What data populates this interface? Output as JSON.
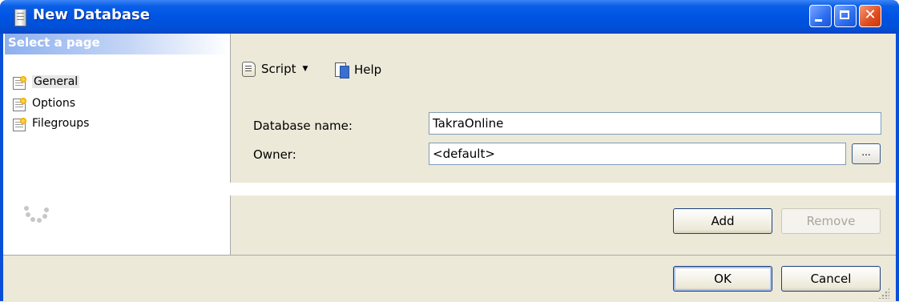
{
  "window": {
    "title": "New Database"
  },
  "sidebar": {
    "header": "Select a page",
    "items": [
      {
        "label": "General",
        "selected": true
      },
      {
        "label": "Options",
        "selected": false
      },
      {
        "label": "Filegroups",
        "selected": false
      }
    ]
  },
  "toolbar": {
    "script_label": "Script",
    "help_label": "Help"
  },
  "form": {
    "database_name_label": "Database name:",
    "database_name_value": "TakraOnline",
    "owner_label": "Owner:",
    "owner_value": "<default>",
    "browse_label": "..."
  },
  "actions": {
    "add_label": "Add",
    "remove_label": "Remove"
  },
  "footer": {
    "ok_label": "OK",
    "cancel_label": "Cancel"
  },
  "colors": {
    "titlebar": "#0055e5",
    "panel": "#ece9d8",
    "sidebar_header": "#8fb0ee"
  }
}
